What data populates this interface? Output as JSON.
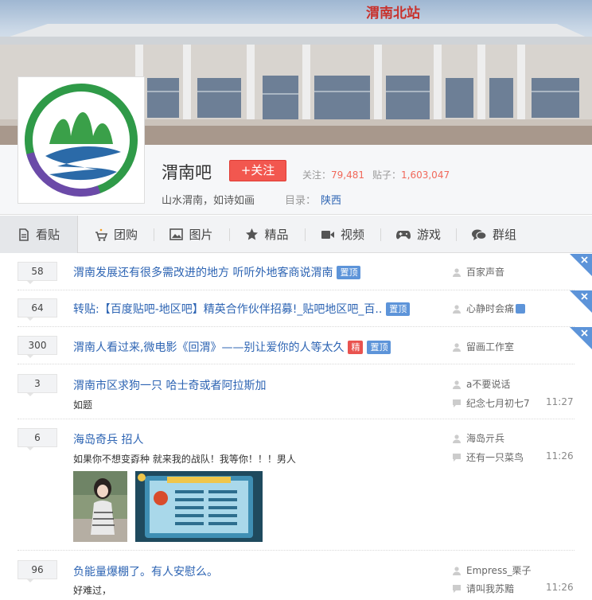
{
  "banner": {
    "station_sign": "渭南北站"
  },
  "forum": {
    "name": "渭南吧",
    "follow_label": "+关注",
    "followers_label": "关注：",
    "followers": "79,481",
    "posts_label": "贴子：",
    "posts": "1,603,047",
    "slogan": "山水渭南，如诗如画",
    "directory_label": "目录：",
    "directory": "陕西"
  },
  "tabs": [
    {
      "label": "看贴",
      "icon": "document-icon"
    },
    {
      "label": "团购",
      "icon": "cart-icon"
    },
    {
      "label": "图片",
      "icon": "image-icon"
    },
    {
      "label": "精品",
      "icon": "star-icon"
    },
    {
      "label": "视频",
      "icon": "video-icon"
    },
    {
      "label": "游戏",
      "icon": "gamepad-icon"
    },
    {
      "label": "群组",
      "icon": "chat-icon"
    }
  ],
  "threads": [
    {
      "replies": "58",
      "title": "渭南发展还有很多需改进的地方 听听外地客商说渭南",
      "badges": [
        "置顶"
      ],
      "author": "百家声音"
    },
    {
      "replies": "64",
      "title": "转贴:【百度贴吧-地区吧】精英合作伙伴招募!_贴吧地区吧_百..",
      "badges": [
        "置顶"
      ],
      "author": "心静时会痛"
    },
    {
      "replies": "300",
      "title": "渭南人看过来,微电影《回渭》——别让爱你的人等太久",
      "badges": [
        "精",
        "置顶"
      ],
      "author": "留画工作室"
    },
    {
      "replies": "3",
      "title": "渭南市区求狗一只 哈士奇或者阿拉斯加",
      "excerpt": "如题",
      "author": "a不要说话",
      "last_reply": "纪念七月初七7",
      "time": "11:27"
    },
    {
      "replies": "6",
      "title": "海岛奇兵 招人",
      "excerpt": "如果你不想变孬种 就来我的战队！我等你！！！男人",
      "author": "海岛亓兵",
      "last_reply": "还有一只菜鸟",
      "time": "11:26"
    },
    {
      "replies": "96",
      "title": "负能量爆棚了。有人安慰么。",
      "excerpt": "好难过，",
      "author": "Empress_栗子",
      "last_reply": "请叫我苏黯",
      "time": "11:26"
    }
  ],
  "colors": {
    "accent": "#2d64b3",
    "follow": "#f2574f",
    "stat": "#f1685a",
    "badge": "#5d94d9",
    "jing": "#e9534f"
  }
}
